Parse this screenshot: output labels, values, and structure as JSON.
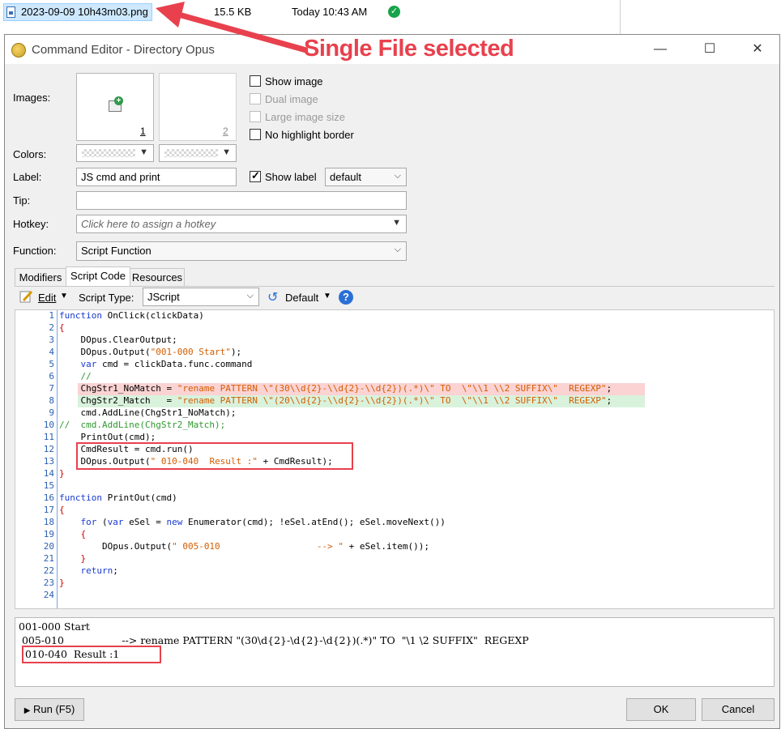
{
  "file_row": {
    "name": "2023-09-09 10h43m03.png",
    "size": "15.5 KB",
    "date": "Today  10:43 AM",
    "status_icon": "checkmark-icon"
  },
  "annotation": {
    "text": "Single File selected",
    "color": "#e8414d"
  },
  "window": {
    "title": "Command Editor - Directory Opus",
    "minimize": "—",
    "maximize": "☐",
    "close": "✕"
  },
  "form": {
    "images_label": "Images:",
    "image_slot_1": "1",
    "image_slot_2": "2",
    "show_image": "Show image",
    "dual_image": "Dual image",
    "large_image_size": "Large image size",
    "no_highlight_border": "No highlight border",
    "colors_label": "Colors:",
    "label_label": "Label:",
    "label_value": "JS cmd and print",
    "show_label": "Show label",
    "show_label_style": "default",
    "tip_label": "Tip:",
    "tip_value": "",
    "hotkey_label": "Hotkey:",
    "hotkey_placeholder": "Click here to assign a hotkey",
    "function_label": "Function:",
    "function_value": "Script Function"
  },
  "tabs": [
    "Modifiers",
    "Script Code",
    "Resources"
  ],
  "toolbar": {
    "edit_label": "Edit",
    "script_type_label": "Script Type:",
    "script_type_value": "JScript",
    "default_label": "Default"
  },
  "code_lines": [
    "function OnClick(clickData)",
    "{",
    "    DOpus.ClearOutput;",
    "    DOpus.Output(\"001-000 Start\");",
    "    var cmd = clickData.func.command",
    "    //",
    "    ChgStr1_NoMatch = \"rename PATTERN \\\"(30\\\\d{2}-\\\\d{2}-\\\\d{2})(.*)\\\" TO  \\\"\\\\1 \\\\2 SUFFIX\\\"  REGEXP\";",
    "    ChgStr2_Match   = \"rename PATTERN \\\"(20\\\\d{2}-\\\\d{2}-\\\\d{2})(.*)\\\" TO  \\\"\\\\1 \\\\2 SUFFIX\\\"  REGEXP\";",
    "    cmd.AddLine(ChgStr1_NoMatch);",
    "//  cmd.AddLine(ChgStr2_Match);",
    "    PrintOut(cmd);",
    "    CmdResult = cmd.run()",
    "    DOpus.Output(\" 010-040  Result :\" + CmdResult);",
    "}",
    "",
    "function PrintOut(cmd)",
    "{",
    "    for (var eSel = new Enumerator(cmd); !eSel.atEnd(); eSel.moveNext())",
    "    {",
    "        DOpus.Output(\" 005-010                  --> \" + eSel.item());",
    "    }",
    "    return;",
    "}",
    ""
  ],
  "output_lines": [
    "001-000 Start",
    " 005-010                  --> rename PATTERN \"(30\\d{2}-\\d{2}-\\d{2})(.*)\" TO  \"\\1 \\2 SUFFIX\"  REGEXP",
    "010-040  Result :1"
  ],
  "buttons": {
    "run": "Run (F5)",
    "ok": "OK",
    "cancel": "Cancel"
  }
}
